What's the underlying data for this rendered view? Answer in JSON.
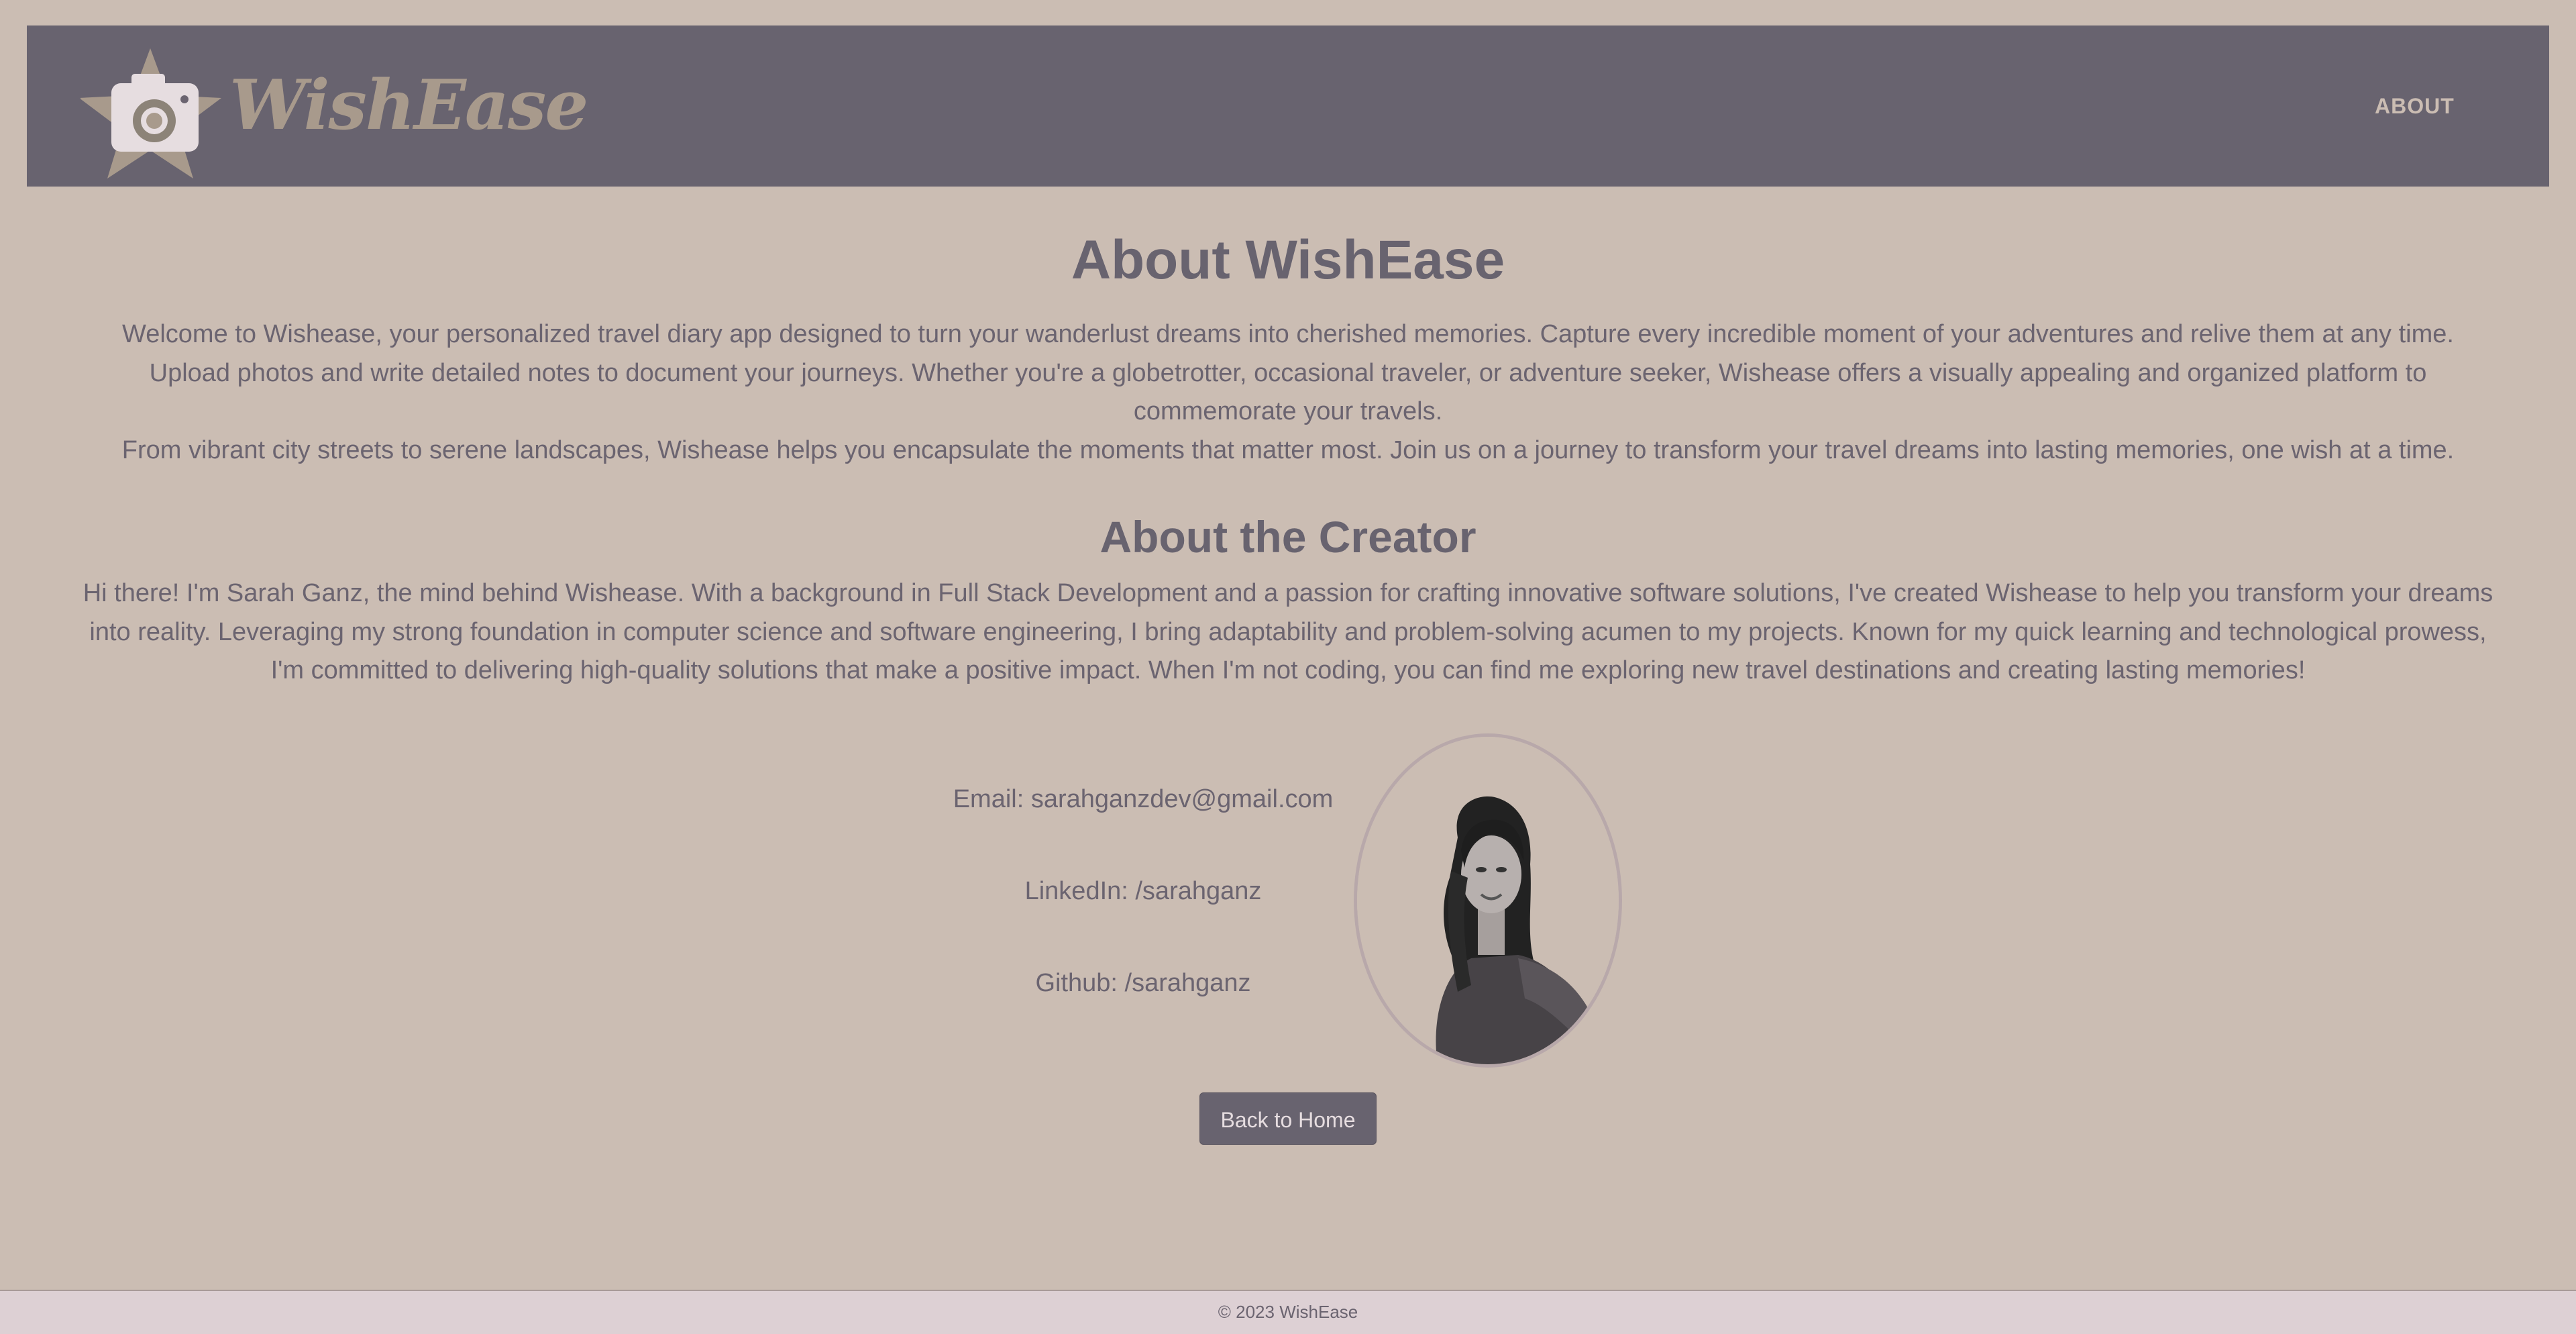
{
  "navbar": {
    "brand": "WishEase",
    "links": [
      {
        "label": "ABOUT"
      }
    ]
  },
  "about": {
    "title": "About WishEase",
    "paragraph_lines": [
      "Welcome to Wishease, your personalized travel diary app designed to turn your wanderlust dreams into cherished memories. Capture every incredible moment of your adventures and relive them at any time.",
      "Upload photos and write detailed notes to document your journeys. Whether you're a globetrotter, occasional traveler, or adventure seeker, Wishease offers a visually appealing and organized platform to",
      "commemorate your travels.",
      "From vibrant city streets to serene landscapes, Wishease helps you encapsulate the moments that matter most. Join us on a journey to transform your travel dreams into lasting memories, one wish at a time."
    ]
  },
  "creator": {
    "title": "About the Creator",
    "paragraph_lines": [
      "Hi there! I'm Sarah Ganz, the mind behind Wishease. With a background in Full Stack Development and a passion for crafting innovative software solutions, I've created Wishease to help you transform your dreams",
      "into reality. Leveraging my strong foundation in computer science and software engineering, I bring adaptability and problem-solving acumen to my projects. Known for my quick learning and technological prowess,",
      "I'm committed to delivering high-quality solutions that make a positive impact. When I'm not coding, you can find me exploring new travel destinations and creating lasting memories!"
    ]
  },
  "contact": {
    "email": "Email: sarahganzdev@gmail.com",
    "linkedin": "LinkedIn: /sarahganz",
    "github": "Github: /sarahganz"
  },
  "buttons": {
    "back_home": "Back to Home"
  },
  "footer": {
    "copyright": "© 2023 WishEase"
  },
  "colors": {
    "page_bg": "#cbbdb3",
    "navbar_bg": "#68636f",
    "logo_star": "#a89a8c",
    "heading": "#68636f",
    "body_text": "#6b6470",
    "footer_bg": "#ddd0d4"
  },
  "icons": {
    "logo": "camera-star-logo-icon"
  }
}
